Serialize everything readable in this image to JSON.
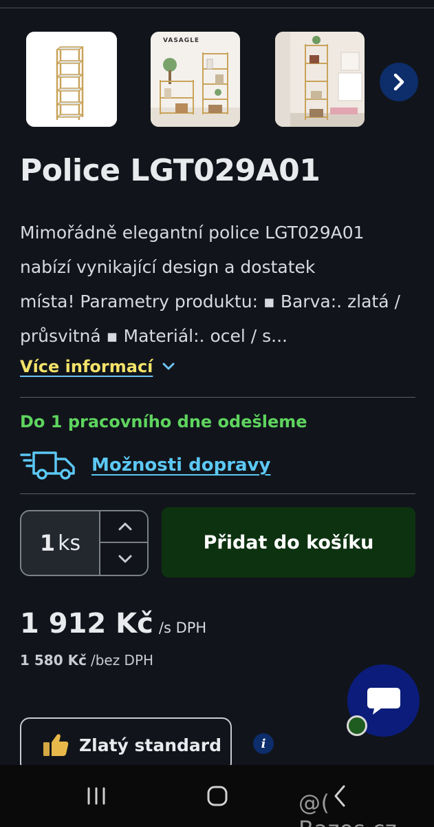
{
  "gallery": {
    "thumbnails": [
      {
        "label": "shelf-product-photo"
      },
      {
        "label": "shelf-lifestyle-photo",
        "brand": "VASAGLE"
      },
      {
        "label": "shelf-room-photo"
      }
    ],
    "next_icon": "chevron-right-icon"
  },
  "product": {
    "title": "Police LGT029A01",
    "description_lines": [
      "Mimořádně elegantní police LGT029A01",
      "nabízí vynikající design a dostatek",
      "místa! Parametry produktu: ▪ Barva:. zlatá /",
      "průsvitná ▪ Materiál:. ocel / s..."
    ],
    "more_info": "Více informací"
  },
  "shipping": {
    "dispatch_text": "Do 1 pracovního dne odešleme",
    "delivery_options": "Možnosti dopravy"
  },
  "cart": {
    "quantity": "1",
    "unit": "ks",
    "add_button": "Přidat do košíku"
  },
  "pricing": {
    "price_with_vat": "1 912 Kč",
    "with_vat_suffix": "/s DPH",
    "price_without_vat": "1 580 Kč",
    "without_vat_suffix": "/bez DPH"
  },
  "badge": {
    "label": "Zlatý standard",
    "info": "i"
  },
  "watermark": "@( Bazos.cz",
  "colors": {
    "background": "#11151b",
    "ship_green": "#5fd45f",
    "link_blue": "#5cc8f5",
    "more_yellow": "#f3e26a",
    "cart_button": "#0d3210",
    "chat_button": "#0b1c7a",
    "next_button": "#0d2d6b"
  }
}
